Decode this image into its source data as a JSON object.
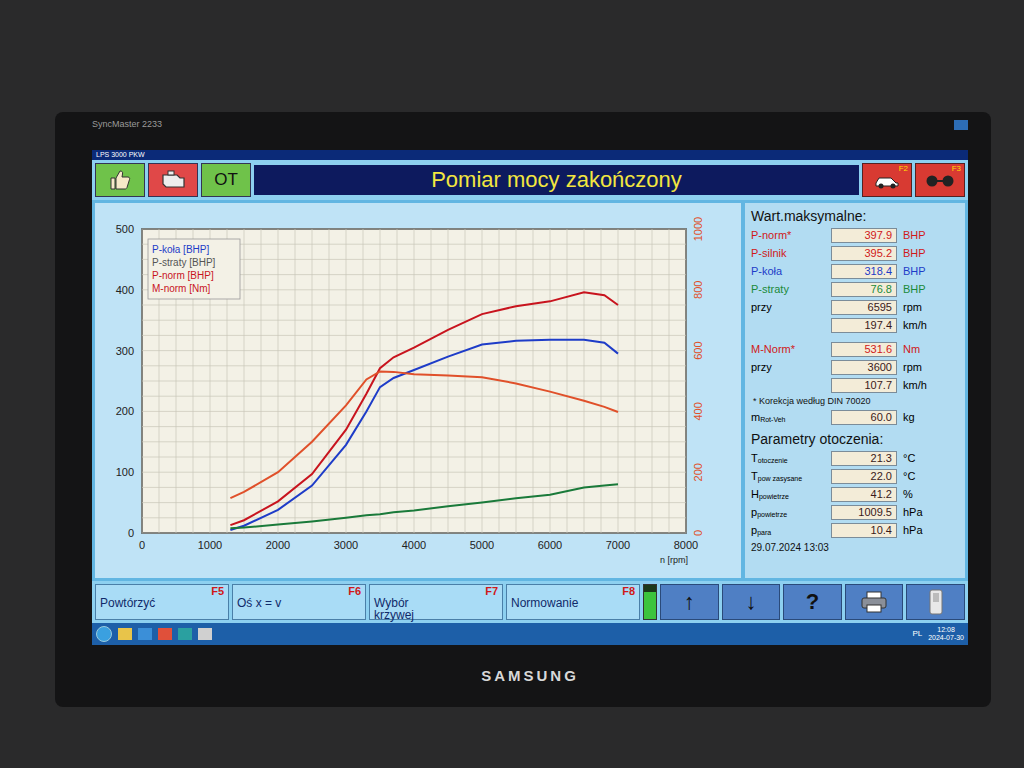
{
  "monitor": {
    "model": "SyncMaster 2233",
    "brand": "SAMSUNG"
  },
  "app": {
    "title": "LPS 3000 PKW"
  },
  "toolbar": {
    "buttons": [
      {
        "kind": "thumb",
        "label": "",
        "color": "#6fc24a"
      },
      {
        "kind": "engine",
        "label": "",
        "color": "#e04848"
      },
      {
        "kind": "text",
        "label": "OT",
        "color": "#6fc24a"
      }
    ],
    "status": "Pomiar mocy zakończony",
    "keys": [
      {
        "key": "F2",
        "kind": "car"
      },
      {
        "key": "F3",
        "kind": "wheels"
      }
    ]
  },
  "chart": {
    "y_left_ticks": [
      "0",
      "100",
      "200",
      "300",
      "400",
      "500"
    ],
    "y_right_ticks": [
      "0",
      "200",
      "400",
      "600",
      "800",
      "1000"
    ],
    "x_ticks": [
      "0",
      "1000",
      "2000",
      "3000",
      "4000",
      "5000",
      "6000",
      "7000",
      "8000"
    ],
    "x_label": "n [rpm]",
    "rpm": [
      1300,
      1500,
      2000,
      2500,
      3000,
      3300,
      3500,
      3700,
      4000,
      4500,
      5000,
      5500,
      6000,
      6500,
      6800,
      7000
    ],
    "series": [
      {
        "label": "P-koła [BHP]",
        "color": "#1e3cc8",
        "legend_color": "#1e3cc8",
        "axis": "left",
        "values": [
          5,
          12,
          38,
          78,
          145,
          200,
          240,
          255,
          268,
          290,
          310,
          316,
          318,
          318,
          313,
          295
        ]
      },
      {
        "label": "P-straty [BHP]",
        "color": "#1a7a3a",
        "legend_color": "#555555",
        "axis": "left",
        "values": [
          8,
          9,
          14,
          19,
          25,
          29,
          31,
          34,
          37,
          44,
          50,
          57,
          63,
          75,
          78,
          80
        ]
      },
      {
        "label": "P-norm [BHP]",
        "color": "#c8141e",
        "legend_color": "#c8141e",
        "axis": "left",
        "values": [
          13,
          21,
          52,
          97,
          170,
          229,
          271,
          289,
          305,
          334,
          360,
          373,
          381,
          396,
          391,
          375
        ]
      },
      {
        "label": "M-norm [Nm]",
        "color": "#e0502a",
        "legend_color": "#c8141e",
        "axis": "right",
        "values": [
          115,
          135,
          200,
          300,
          420,
          505,
          531.6,
          530,
          522,
          518,
          512,
          492,
          465,
          435,
          415,
          398
        ]
      }
    ]
  },
  "max_values": {
    "title": "Wart.maksymalne:",
    "power_rows": [
      {
        "label": "P-norm*",
        "value": "397.9",
        "unit": "BHP",
        "color": "#d01818"
      },
      {
        "label": "P-silnik",
        "value": "395.2",
        "unit": "BHP",
        "color": "#d01818"
      },
      {
        "label": "P-koła",
        "value": "318.4",
        "unit": "BHP",
        "color": "#1e3cc8"
      },
      {
        "label": "P-straty",
        "value": "76.8",
        "unit": "BHP",
        "color": "#1a8a3a"
      },
      {
        "label": "przy",
        "value": "6595",
        "unit": "rpm",
        "color": "#000000"
      },
      {
        "label": "",
        "value": "197.4",
        "unit": "km/h",
        "color": "#000000"
      }
    ],
    "torque_rows": [
      {
        "label": "M-Norm*",
        "value": "531.6",
        "unit": "Nm",
        "color": "#d01818"
      },
      {
        "label": "przy",
        "value": "3600",
        "unit": "rpm",
        "color": "#000000"
      },
      {
        "label": "",
        "value": "107.7",
        "unit": "km/h",
        "color": "#000000"
      }
    ],
    "note": "* Korekcja według DIN 70020",
    "mass": {
      "symbol": "m",
      "sub": "Rot-Veh",
      "value": "60.0",
      "unit": "kg"
    }
  },
  "environment": {
    "title": "Parametry otoczenia:",
    "rows": [
      {
        "symbol": "T",
        "sub": "otoczenie",
        "value": "21.3",
        "unit": "°C"
      },
      {
        "symbol": "T",
        "sub": "pow zasysane",
        "value": "22.0",
        "unit": "°C"
      },
      {
        "symbol": "H",
        "sub": "powietrze",
        "value": "41.2",
        "unit": "%"
      },
      {
        "symbol": "p",
        "sub": "powietrze",
        "value": "1009.5",
        "unit": "hPa"
      },
      {
        "symbol": "p",
        "sub": "para",
        "value": "10.4",
        "unit": "hPa"
      }
    ],
    "date": "29.07.2024 13:03"
  },
  "bottom_bar": {
    "keys": [
      {
        "key": "F5",
        "label": "Powtórzyć"
      },
      {
        "key": "F6",
        "label": "Oś x = v"
      },
      {
        "key": "F7",
        "label": "Wybór\nkrzywej"
      },
      {
        "key": "F8",
        "label": "Normowanie"
      }
    ],
    "indicator": {
      "level": 0.8
    },
    "nav": [
      {
        "kind": "text",
        "label": "↑"
      },
      {
        "kind": "text",
        "label": "↓"
      },
      {
        "kind": "text",
        "label": "?"
      },
      {
        "kind": "printer",
        "label": ""
      },
      {
        "kind": "switch",
        "label": ""
      }
    ]
  },
  "taskbar": {
    "language": "PL",
    "time": "12:08",
    "date": "2024-07-30"
  }
}
